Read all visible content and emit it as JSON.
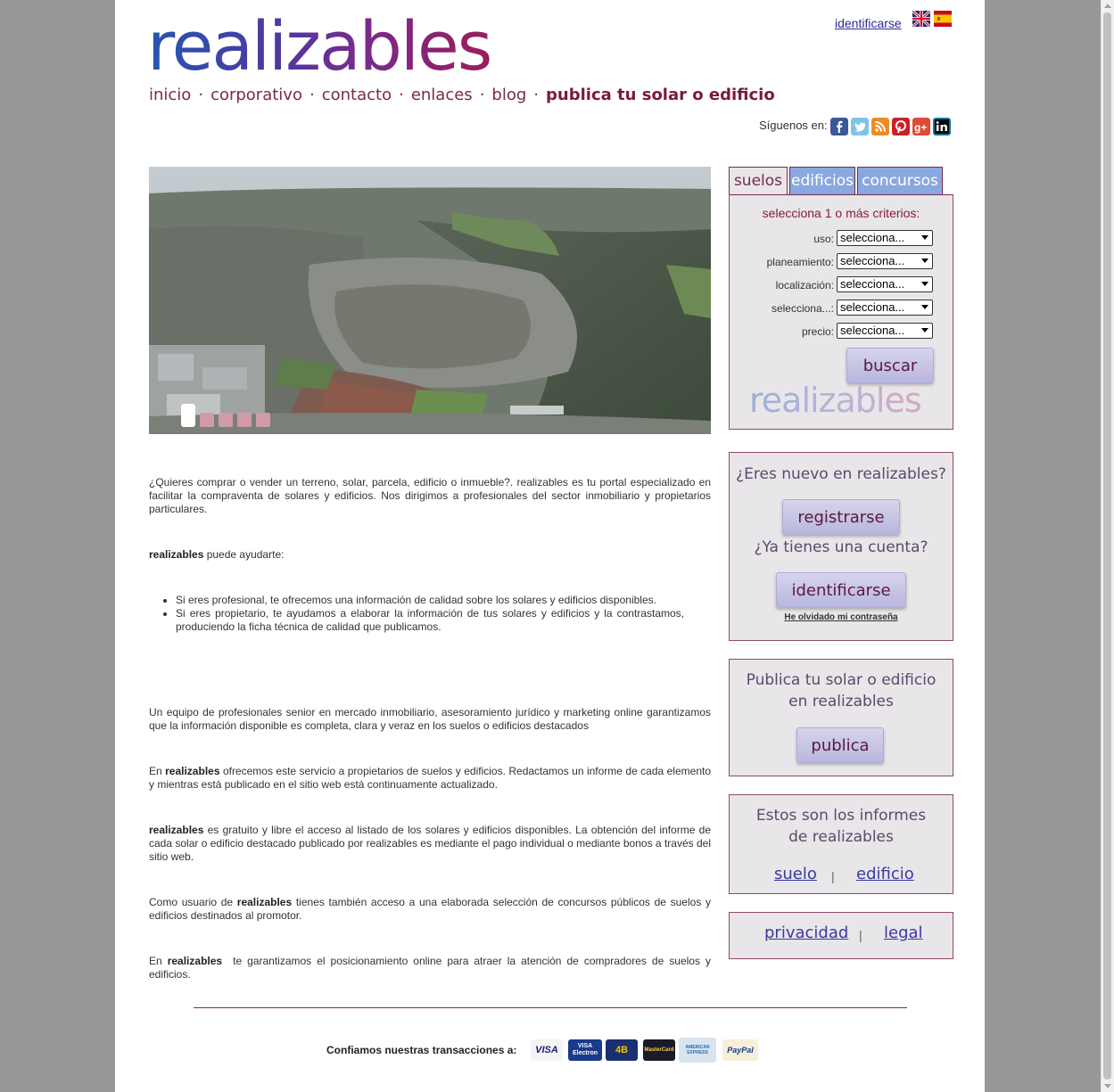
{
  "brand": {
    "logo_text": "realizables",
    "watermark": "realizables"
  },
  "header": {
    "login_link": "identificarse",
    "follow_label": "Síguenos en:",
    "social_icons": [
      "facebook-icon",
      "twitter-icon",
      "rss-icon",
      "pinterest-icon",
      "googleplus-icon",
      "linkedin-icon"
    ]
  },
  "nav": {
    "items": [
      "inicio",
      "corporativo",
      "contacto",
      "enlaces",
      "blog"
    ],
    "highlight": "publica tu solar o edificio",
    "separator": "·"
  },
  "slider": {
    "total_slides": 5,
    "active_slide": 1
  },
  "search": {
    "tabs": [
      "suelos",
      "edificios",
      "concursos"
    ],
    "active_tab": "suelos",
    "title": "selecciona 1 o más criterios:",
    "fields": [
      {
        "label": "uso:",
        "value": "selecciona..."
      },
      {
        "label": "planeamiento:",
        "value": "selecciona..."
      },
      {
        "label": "localización:",
        "value": "selecciona..."
      },
      {
        "label": "selecciona...:",
        "value": "selecciona..."
      },
      {
        "label": "precio:",
        "value": "selecciona..."
      }
    ],
    "button": "buscar"
  },
  "account_box": {
    "new_question": "¿Eres nuevo en realizables?",
    "register_button": "registrarse",
    "have_account": "¿Ya tienes una cuenta?",
    "login_button": "identificarse",
    "forgot_link": "He olvidado mi contraseña"
  },
  "publish_box": {
    "text": "Publica tu solar o edificio en realizables",
    "button": "publica"
  },
  "reports_box": {
    "text": "Estos son los informes de realizables",
    "link_suelo": "suelo",
    "separator": "|",
    "link_edificio": "edificio"
  },
  "legal_box": {
    "link_privacidad": "privacidad",
    "separator": "|",
    "link_legal": "legal"
  },
  "content": {
    "intro": "¿Quieres comprar o vender un terreno, solar, parcela, edificio o inmueble?. realizables es tu portal especializado en facilitar la compraventa de solares y edificios. Nos dirigimos a profesionales del sector inmobiliario y propietarios particulares.",
    "help_bold": "realizables",
    "help_rest": " puede ayudarte:",
    "bullets": [
      "Si eres profesional, te ofrecemos una información de calidad sobre los solares y edificios disponibles.",
      "Si eres propietario, te ayudamos a elaborar la información de tus solares y edificios y la contrastamos, produciendo la ficha técnica de calidad que publicamos."
    ],
    "team": "Un equipo de profesionales senior en mercado inmobiliario, asesoramiento jurídico y marketing online garantizamos que la información disponible es completa, clara y veraz en los suelos o edificios destacados",
    "p1_pre": "En ",
    "p1_bold": "realizables",
    "p1_rest": " ofrecemos este servicio a propietarios de suelos y edificios. Redactamos un informe de cada elemento y mientras está publicado en el sitio web está continuamente actualizado.",
    "p2_bold": "realizables",
    "p2_rest": " es gratuito y libre el acceso al listado de los solares y edificios disponibles. La obtención del informe de cada solar o edificio destacado publicado por realizables es mediante el pago individual o mediante bonos a través del sitio web.",
    "p3_pre": "Como usuario de ",
    "p3_bold": "realizables",
    "p3_rest": " tienes también acceso a una elaborada selección de concursos públicos de suelos y edificios destinados al promotor.",
    "p4_pre": "En ",
    "p4_bold": "realizables",
    "p4_rest": "  te garantizamos el posicionamiento online para atraer la atención de compradores de suelos y edificios."
  },
  "footer": {
    "trust_label": "Confiamos nuestras transacciones a:",
    "cards": [
      "VISA",
      "VISA Electron",
      "4B",
      "MasterCard",
      "AMERICAN EXPRESS",
      "PayPal"
    ]
  },
  "colors": {
    "accent": "#7a2a4a",
    "tab_inactive": "#8aa8e0",
    "box_bg": "#e8e6e9",
    "button": "#c7c4e6"
  }
}
